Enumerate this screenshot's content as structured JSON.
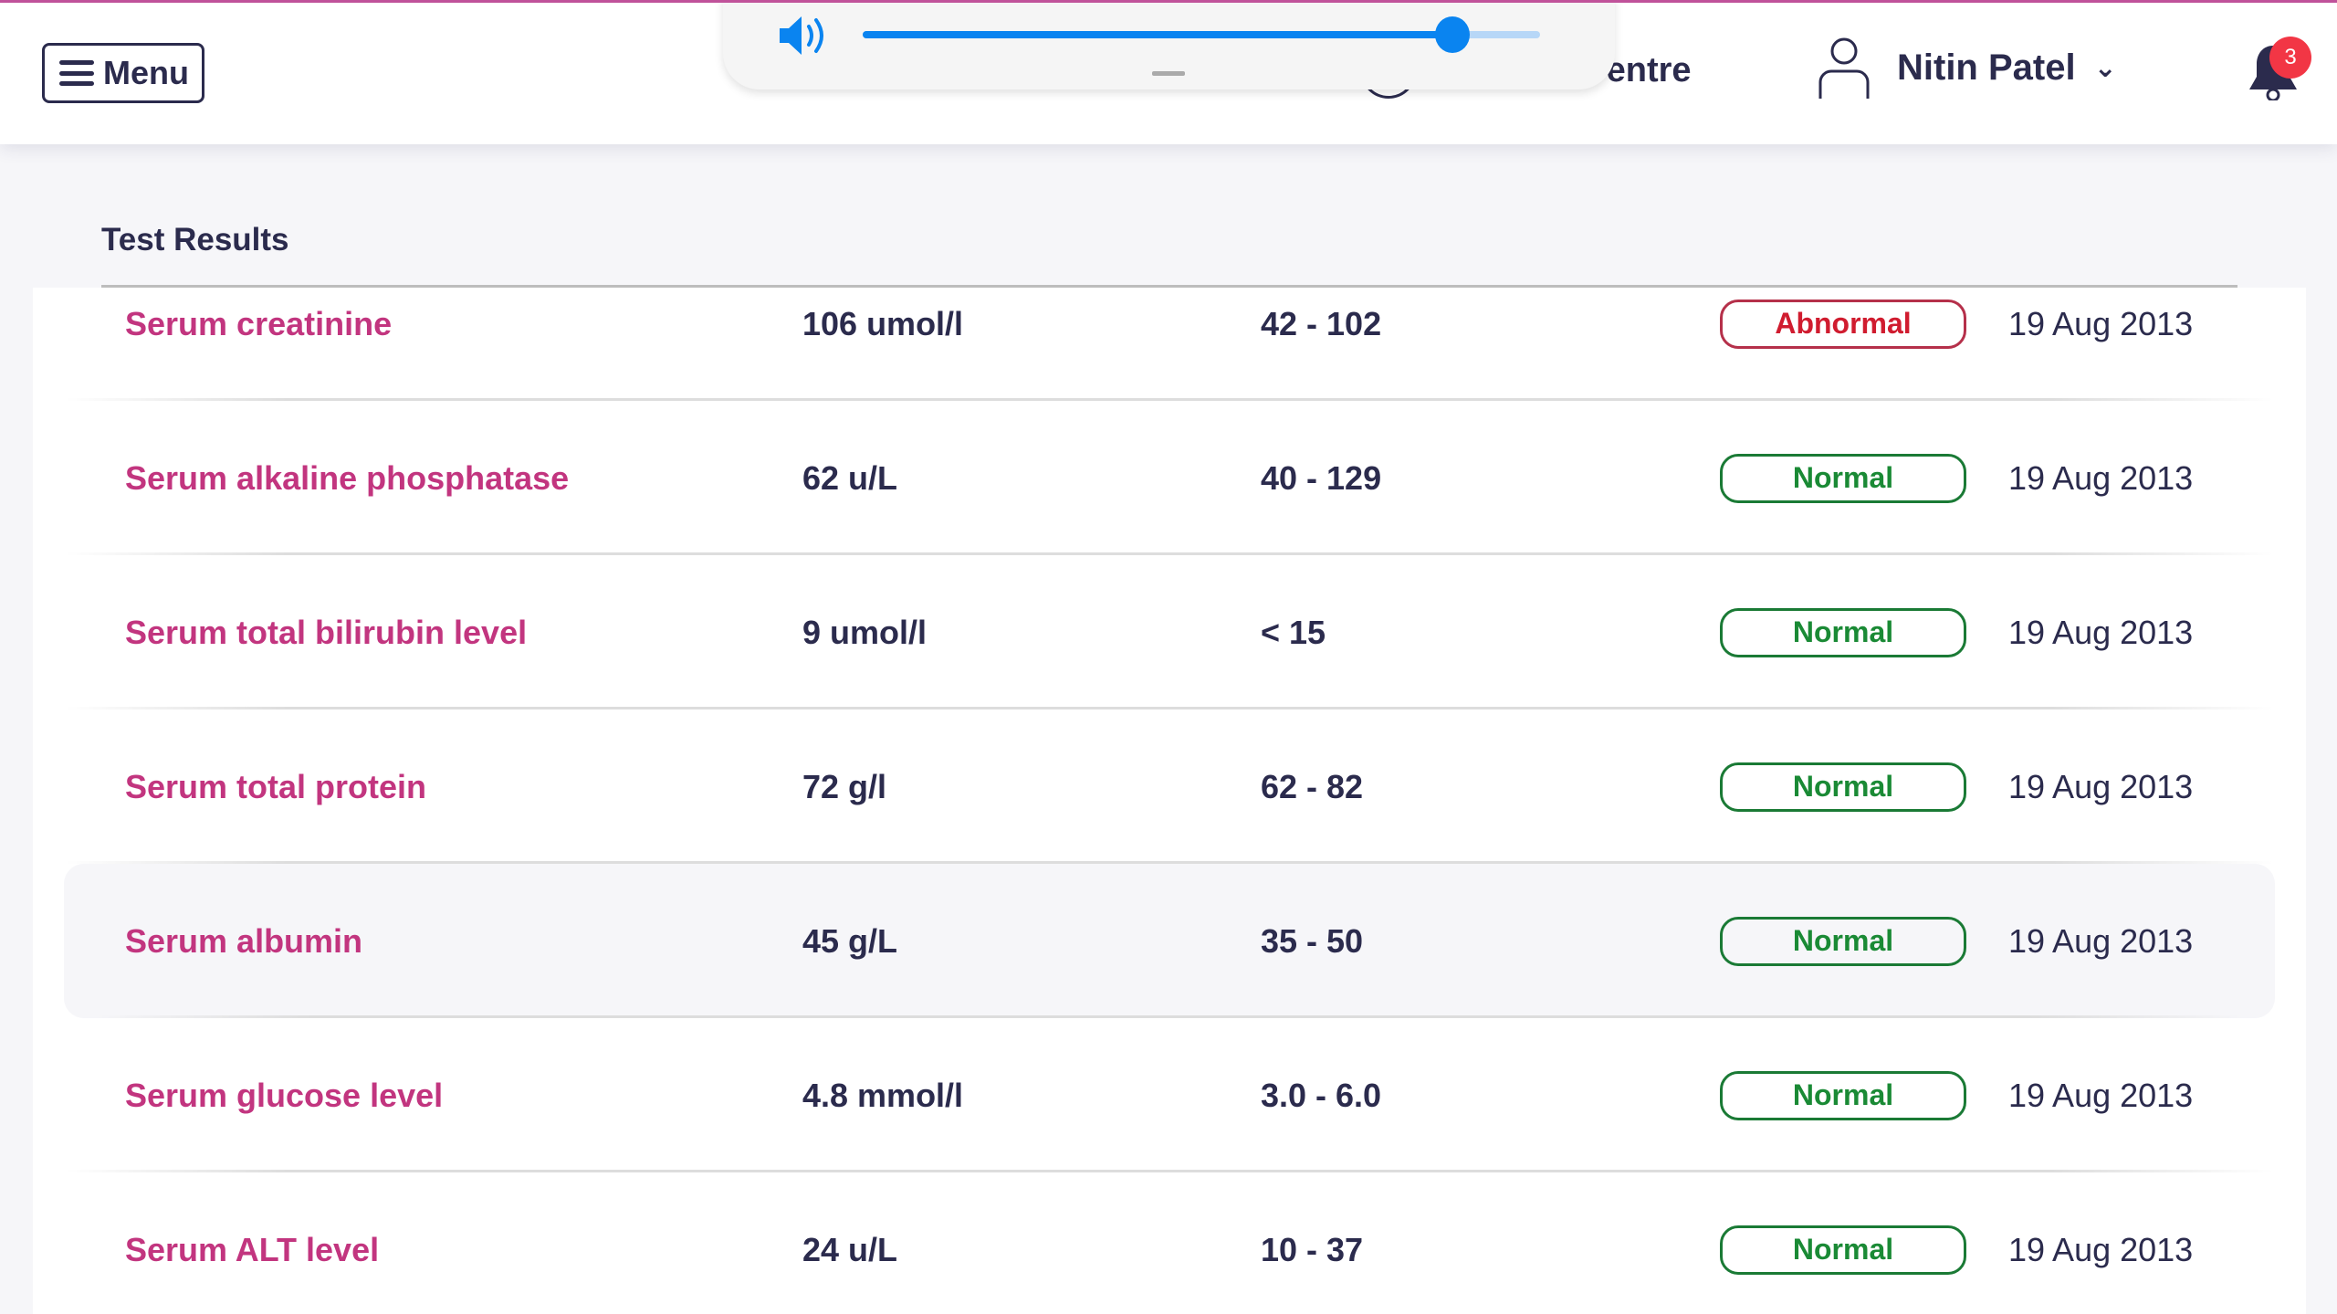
{
  "header": {
    "menu_label": "Menu",
    "support_label": "Support Centre",
    "user_name": "Nitin Patel",
    "notification_count": "3"
  },
  "volume_overlay": {
    "level_percent": 87,
    "accent": "#0a84f0"
  },
  "page": {
    "title": "Test Results"
  },
  "results": [
    {
      "name": "Serum creatinine",
      "value": "106 umol/l",
      "range": "42 - 102",
      "status": "Abnormal",
      "date": "19 Aug 2013"
    },
    {
      "name": "Serum alkaline phosphatase",
      "value": "62 u/L",
      "range": "40 - 129",
      "status": "Normal",
      "date": "19 Aug 2013"
    },
    {
      "name": "Serum total bilirubin level",
      "value": "9 umol/l",
      "range": "< 15",
      "status": "Normal",
      "date": "19 Aug 2013"
    },
    {
      "name": "Serum total protein",
      "value": "72 g/l",
      "range": "62 - 82",
      "status": "Normal",
      "date": "19 Aug 2013"
    },
    {
      "name": "Serum albumin",
      "value": "45 g/L",
      "range": "35 - 50",
      "status": "Normal",
      "date": "19 Aug 2013"
    },
    {
      "name": "Serum glucose level",
      "value": "4.8 mmol/l",
      "range": "3.0 - 6.0",
      "status": "Normal",
      "date": "19 Aug 2013"
    },
    {
      "name": "Serum ALT level",
      "value": "24 u/L",
      "range": "10 - 37",
      "status": "Normal",
      "date": "19 Aug 2013"
    }
  ],
  "colors": {
    "normal": "#1a8a35",
    "abnormal": "#d01c2f",
    "test_name": "#c2357f",
    "badge": "#f23645"
  }
}
